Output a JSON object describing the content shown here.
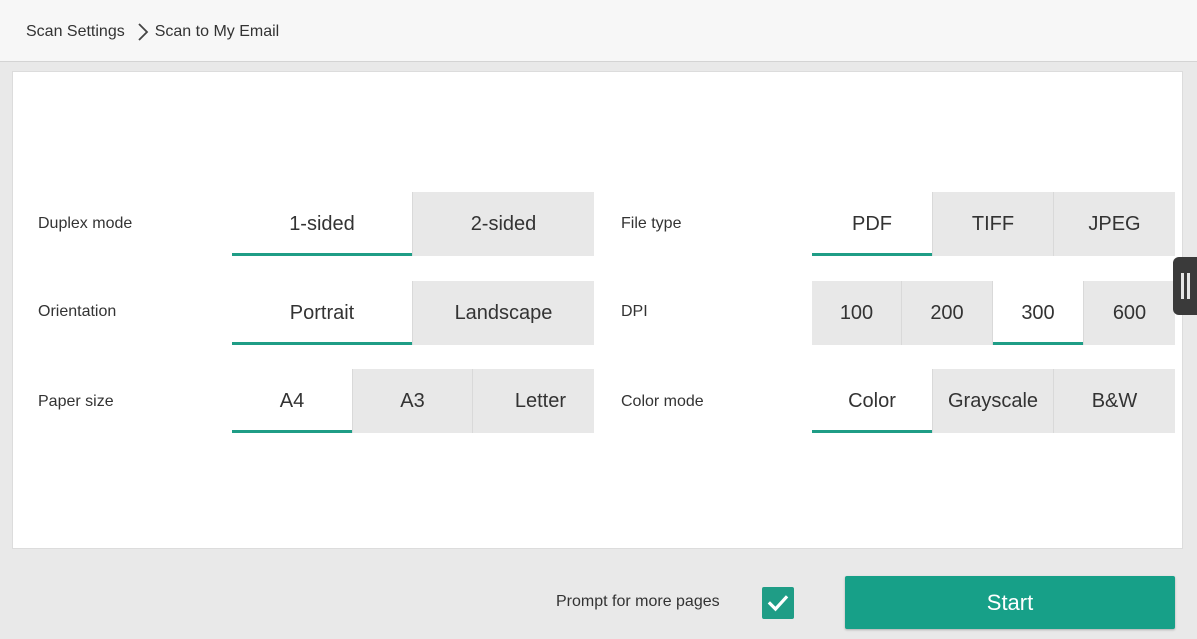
{
  "breadcrumb": {
    "parent": "Scan Settings",
    "current": "Scan to My Email"
  },
  "settings_left": [
    {
      "label": "Duplex mode",
      "options": [
        "1-sided",
        "2-sided"
      ],
      "selected": "1-sided"
    },
    {
      "label": "Orientation",
      "options": [
        "Portrait",
        "Landscape"
      ],
      "selected": "Portrait"
    },
    {
      "label": "Paper size",
      "options": [
        "A4",
        "A3",
        "Letter"
      ],
      "selected": "A4"
    }
  ],
  "settings_right": [
    {
      "label": "File type",
      "options": [
        "PDF",
        "TIFF",
        "JPEG"
      ],
      "selected": "PDF"
    },
    {
      "label": "DPI",
      "options": [
        "100",
        "200",
        "300",
        "600"
      ],
      "selected": "300"
    },
    {
      "label": "Color mode",
      "options": [
        "Color",
        "Grayscale",
        "B&W"
      ],
      "selected": "Color"
    }
  ],
  "footer": {
    "prompt_label": "Prompt for more pages",
    "prompt_checked": true,
    "start_label": "Start"
  },
  "colors": {
    "accent": "#1f9d86",
    "start_button": "#17a088",
    "segment_bg": "#e8e8e8",
    "selected_bg": "#ffffff"
  },
  "icons": {
    "breadcrumb_separator": "chevron-right-icon",
    "checkbox": "check-icon",
    "side_handle": "drag-handle-icon"
  }
}
